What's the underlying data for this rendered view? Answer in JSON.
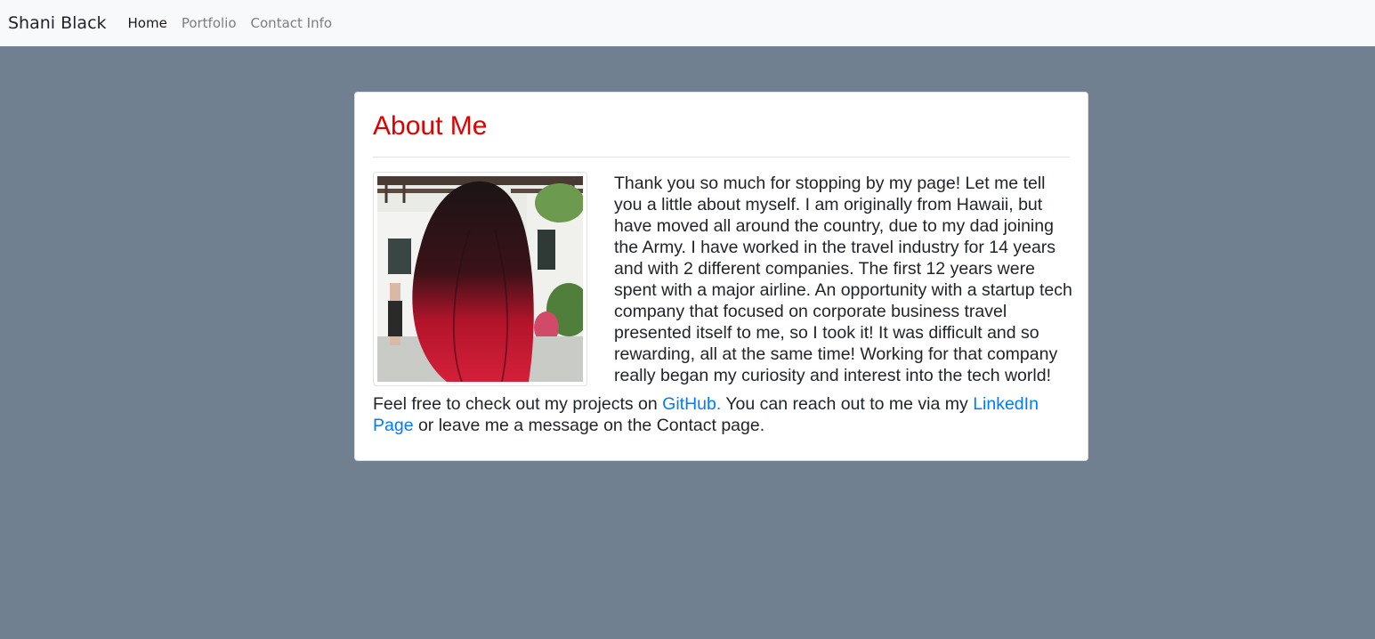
{
  "navbar": {
    "brand": "Shani Black",
    "links": [
      {
        "label": "Home",
        "active": true
      },
      {
        "label": "Portfolio",
        "active": false
      },
      {
        "label": "Contact Info",
        "active": false
      }
    ]
  },
  "about": {
    "title": "About Me",
    "bio": "Thank you so much for stopping by my page! Let me tell you a little about myself. I am originally from Hawaii, but have moved all around the country, due to my dad joining the Army. I have worked in the travel industry for 14 years and with 2 different companies. The first 12 years were spent with a major airline. An opportunity with a startup tech company that focused on corporate business travel presented itself to me, so I took it! It was difficult and so rewarding, all at the same time! Working for that company really began my curiosity and interest into the tech world!",
    "contact": {
      "prefix": "Feel free to check out my projects on ",
      "github_link": "GitHub.",
      "middle": " You can reach out to me via my ",
      "linkedin_link": "LinkedIn Page",
      "suffix": " or leave me a message on the Contact page."
    }
  },
  "colors": {
    "page_background": "#708090",
    "title": "#e00000",
    "link": "#007bff",
    "navbar_background": "#f8f9fa"
  }
}
